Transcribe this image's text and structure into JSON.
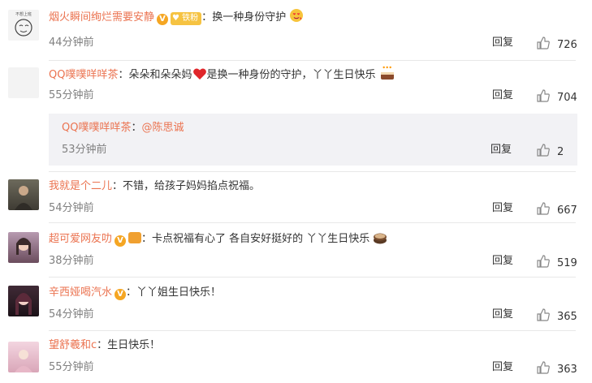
{
  "comments": [
    {
      "username": "烟火瞬间绚烂需要安静",
      "fan_label": "铁粉",
      "colon": "：",
      "text": "换一种身份守护",
      "time": "44分钟前",
      "reply": "回复",
      "likes": "726"
    },
    {
      "username": "QQ噗噗咩咩茶",
      "colon": "：",
      "text_a": "朵朵和朵朵妈",
      "text_b": "是换一种身份的守护，丫丫生日快乐",
      "time": "55分钟前",
      "reply": "回复",
      "likes": "704"
    },
    {
      "username": "我就是个二儿",
      "colon": "：",
      "text": "不错，给孩子妈妈掐点祝福。",
      "time": "54分钟前",
      "reply": "回复",
      "likes": "667"
    },
    {
      "username": "超可爱网友叻",
      "colon": "：",
      "text": "卡点祝福有心了 各自安好挺好的 丫丫生日快乐",
      "time": "38分钟前",
      "reply": "回复",
      "likes": "519"
    },
    {
      "username": "辛西娅喝汽水",
      "colon": "：",
      "text": "丫丫姐生日快乐！",
      "time": "54分钟前",
      "reply": "回复",
      "likes": "365"
    },
    {
      "username": "望舒羲和c",
      "colon": "：",
      "text": "生日快乐！",
      "time": "55分钟前",
      "reply": "回复",
      "likes": "363"
    }
  ],
  "nested_reply": {
    "username": "QQ噗噗咩咩茶",
    "colon": "：",
    "mention": "@陈思诚",
    "time": "53分钟前",
    "reply": "回复",
    "likes": "2"
  },
  "avatar_text": "不想上班",
  "colors": {
    "username": "#eb7350",
    "time": "#808080",
    "nested_bg": "#f2f2f5",
    "badge": "#f5a623"
  }
}
